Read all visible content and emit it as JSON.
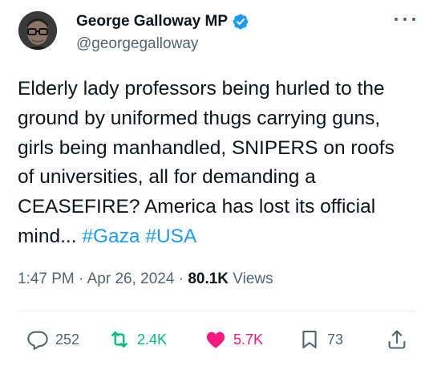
{
  "author": {
    "name": "George Galloway MP",
    "handle": "@georgegalloway"
  },
  "tweet": {
    "text": "Elderly lady professors being hurled to the\nground by uniformed thugs carrying guns,\ngirls being manhandled, SNIPERS on roofs\nof universities, all for demanding a\nCEASEFIRE? America has lost its official\nmind... ",
    "hashtags": [
      "#Gaza",
      "#USA"
    ]
  },
  "meta": {
    "time": "1:47 PM",
    "date": "Apr 26, 2024",
    "views_count": "80.1K",
    "views_label": "Views"
  },
  "actions": {
    "replies": "252",
    "retweets": "2.4K",
    "likes": "5.7K",
    "bookmarks": "73"
  },
  "colors": {
    "accent": "#1d9bf0",
    "retweet": "#00ba7c",
    "like": "#f91880",
    "secondary_text": "#536471"
  },
  "icons": [
    "verified-badge-icon",
    "more-icon",
    "reply-icon",
    "retweet-icon",
    "heart-icon",
    "bookmark-icon",
    "share-icon"
  ]
}
